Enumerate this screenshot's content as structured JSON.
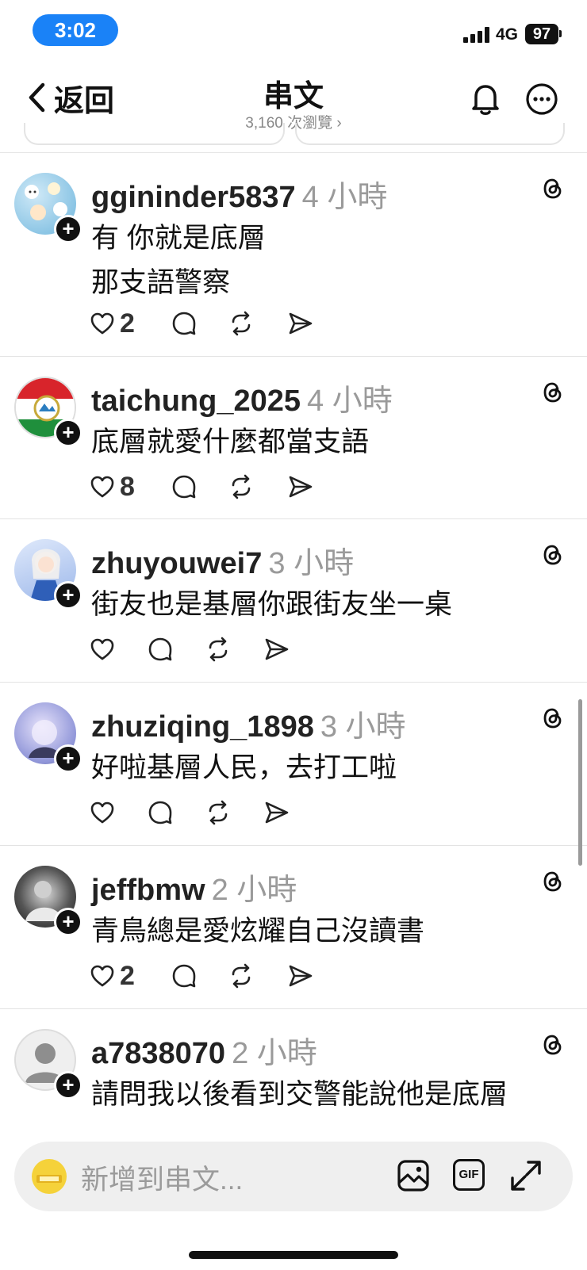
{
  "status_bar": {
    "time": "3:02",
    "network": "4G",
    "battery": "97"
  },
  "nav": {
    "back_label": "返回",
    "title": "串文",
    "views": "3,160 次瀏覽 ›"
  },
  "posts": [
    {
      "username": "ggininder5837",
      "time": "4 小時",
      "lines": [
        "有 你就是底層",
        "那支語警察"
      ],
      "likes": "2"
    },
    {
      "username": "taichung_2025",
      "time": "4 小時",
      "lines": [
        "底層就愛什麼都當支語"
      ],
      "likes": "8"
    },
    {
      "username": "zhuyouwei7",
      "time": "3 小時",
      "lines": [
        "街友也是基層你跟街友坐一桌"
      ],
      "likes": ""
    },
    {
      "username": "zhuziqing_1898",
      "time": "3 小時",
      "lines": [
        "好啦基層人民，去打工啦"
      ],
      "likes": ""
    },
    {
      "username": "jeffbmw",
      "time": "2 小時",
      "lines": [
        "青鳥總是愛炫耀自己沒讀書"
      ],
      "likes": "2"
    },
    {
      "username": "a7838070",
      "time": "2 小時",
      "lines": [
        "請問我以後看到交警能說他是底層"
      ],
      "likes": ""
    }
  ],
  "composer": {
    "placeholder": "新增到串文...",
    "gif_label": "GIF"
  },
  "icons": {
    "back": "chevron-left-icon",
    "bell": "bell-icon",
    "more": "more-icon",
    "threads": "threads-icon",
    "like": "heart-icon",
    "reply": "comment-icon",
    "repost": "repost-icon",
    "share": "send-icon",
    "follow": "plus-icon",
    "image": "image-icon",
    "gif": "gif-icon",
    "expand": "expand-icon"
  },
  "colors": {
    "accent": "#1a82f7",
    "text": "#111111",
    "muted": "#9a9a9a",
    "composer_bg": "#efefef"
  }
}
